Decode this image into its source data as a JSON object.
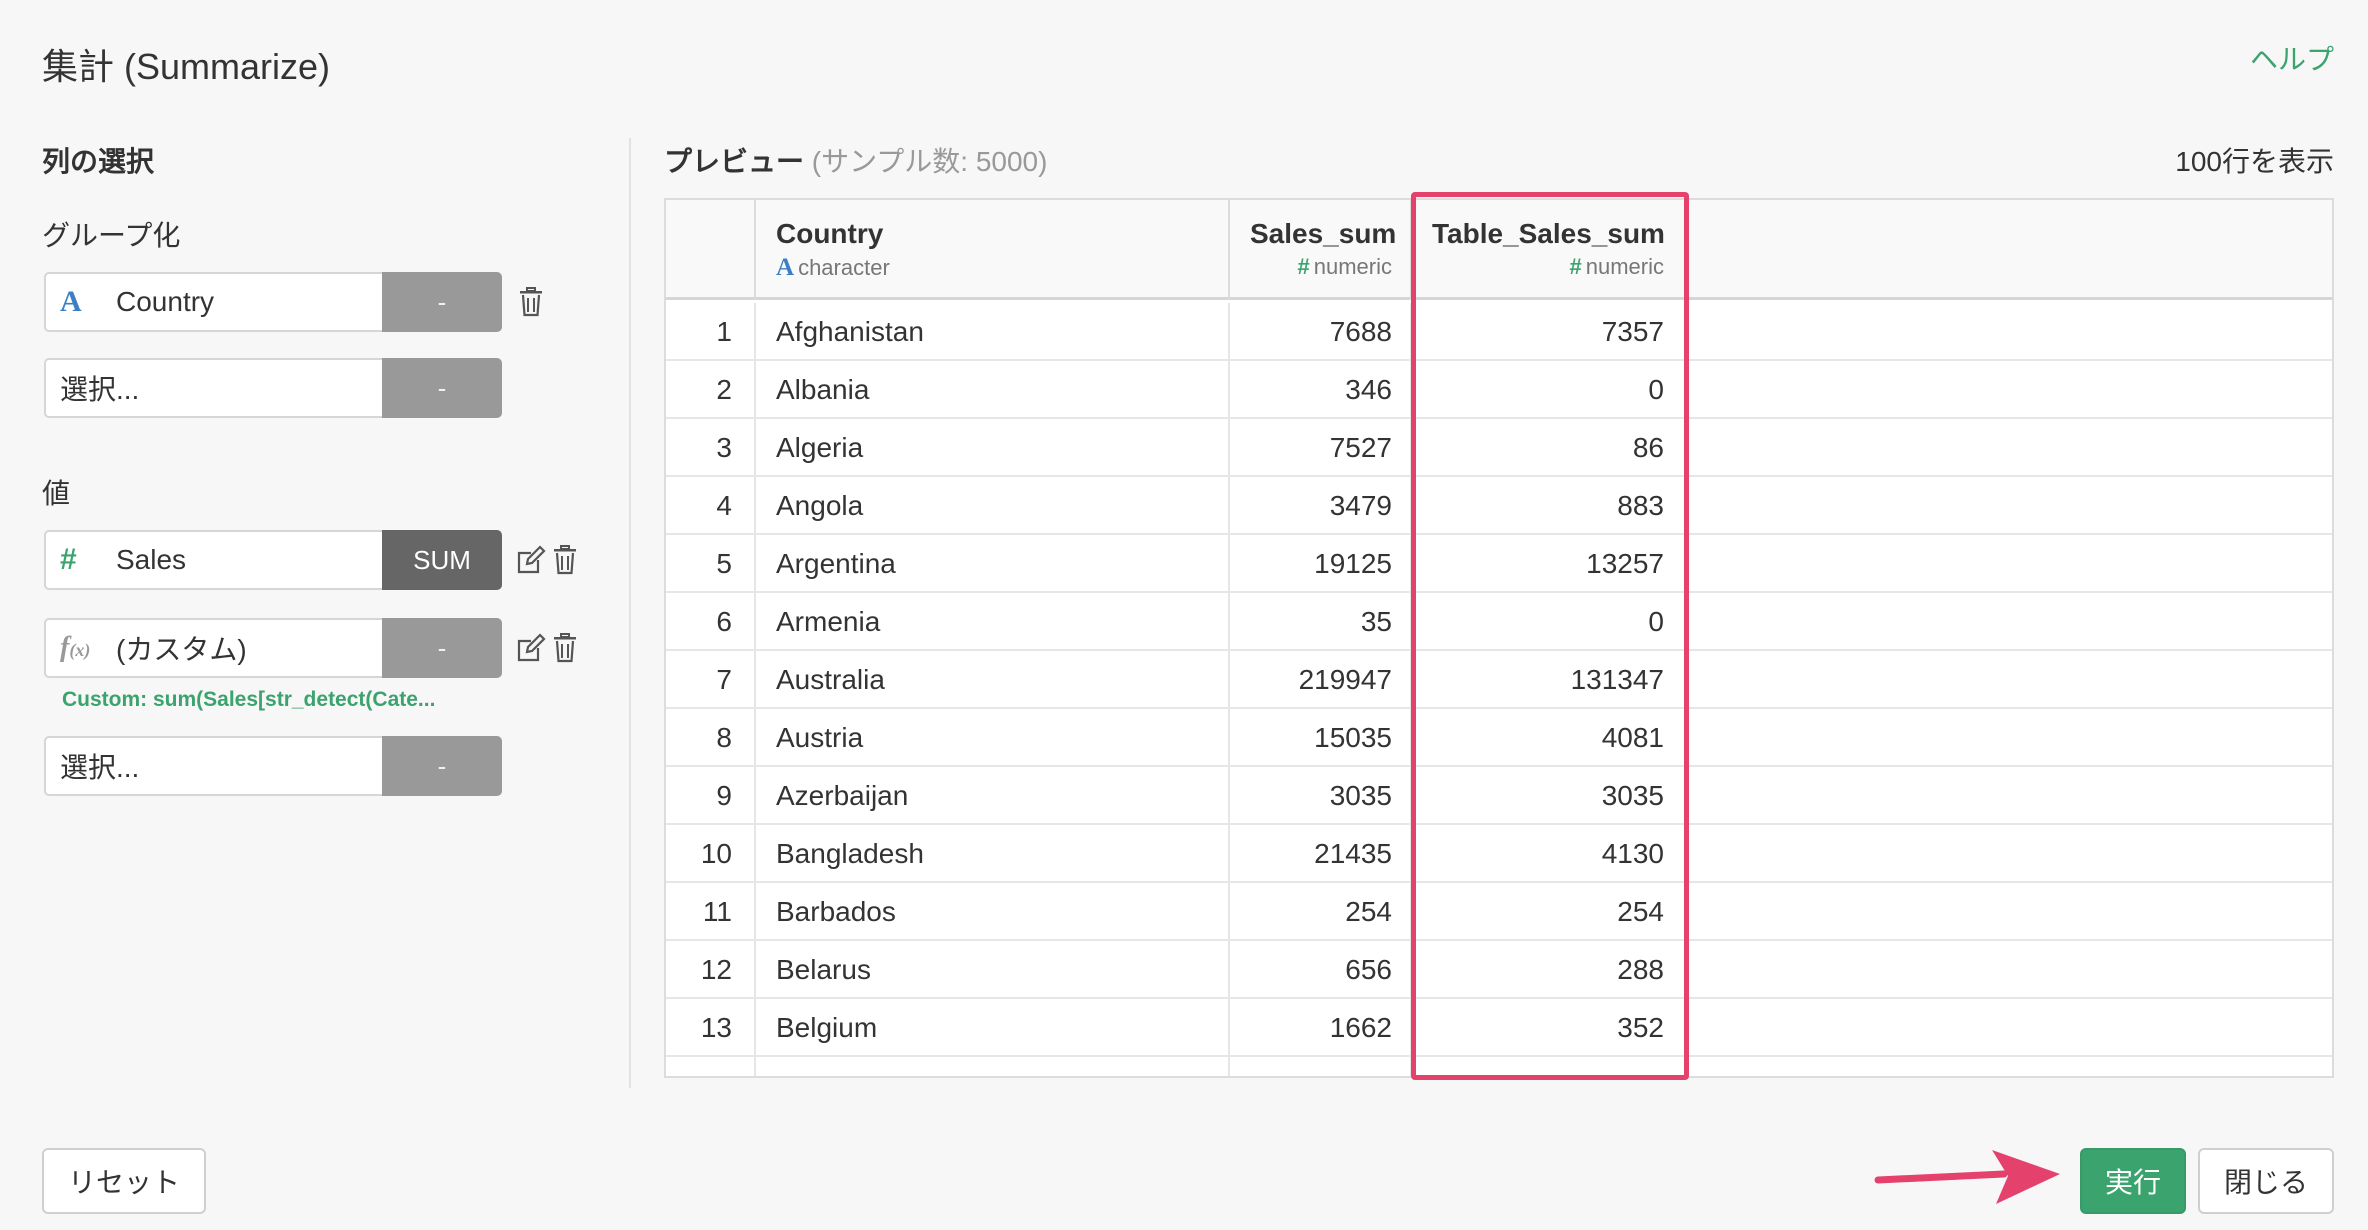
{
  "header": {
    "title": "集計 (Summarize)",
    "help": "ヘルプ"
  },
  "left": {
    "heading": "列の選択",
    "group_label": "グループ化",
    "group_rows": [
      {
        "value": "Country",
        "button": "-"
      },
      {
        "placeholder": "選択...",
        "button": "-"
      }
    ],
    "values_label": "値",
    "value_rows": [
      {
        "value": "Sales",
        "button": "SUM"
      },
      {
        "value": "(カスタム)",
        "button": "-",
        "note": "Custom: sum(Sales[str_detect(Cate..."
      },
      {
        "placeholder": "選択...",
        "button": "-"
      }
    ]
  },
  "preview": {
    "title": "プレビュー",
    "subtitle": "(サンプル数: 5000)",
    "rows_display": "100行を表示",
    "columns": [
      {
        "name": "Country",
        "type": "character"
      },
      {
        "name": "Sales_sum",
        "type": "numeric"
      },
      {
        "name": "Table_Sales_sum",
        "type": "numeric"
      }
    ],
    "rows": [
      [
        "1",
        "Afghanistan",
        "7688",
        "7357"
      ],
      [
        "2",
        "Albania",
        "346",
        "0"
      ],
      [
        "3",
        "Algeria",
        "7527",
        "86"
      ],
      [
        "4",
        "Angola",
        "3479",
        "883"
      ],
      [
        "5",
        "Argentina",
        "19125",
        "13257"
      ],
      [
        "6",
        "Armenia",
        "35",
        "0"
      ],
      [
        "7",
        "Australia",
        "219947",
        "131347"
      ],
      [
        "8",
        "Austria",
        "15035",
        "4081"
      ],
      [
        "9",
        "Azerbaijan",
        "3035",
        "3035"
      ],
      [
        "10",
        "Bangladesh",
        "21435",
        "4130"
      ],
      [
        "11",
        "Barbados",
        "254",
        "254"
      ],
      [
        "12",
        "Belarus",
        "656",
        "288"
      ],
      [
        "13",
        "Belgium",
        "1662",
        "352"
      ]
    ]
  },
  "footer": {
    "reset": "リセット",
    "run": "実行",
    "close": "閉じる"
  },
  "colors": {
    "accent_green": "#3ba36e",
    "highlight": "#e4426d",
    "char_blue": "#3b7fc4"
  }
}
